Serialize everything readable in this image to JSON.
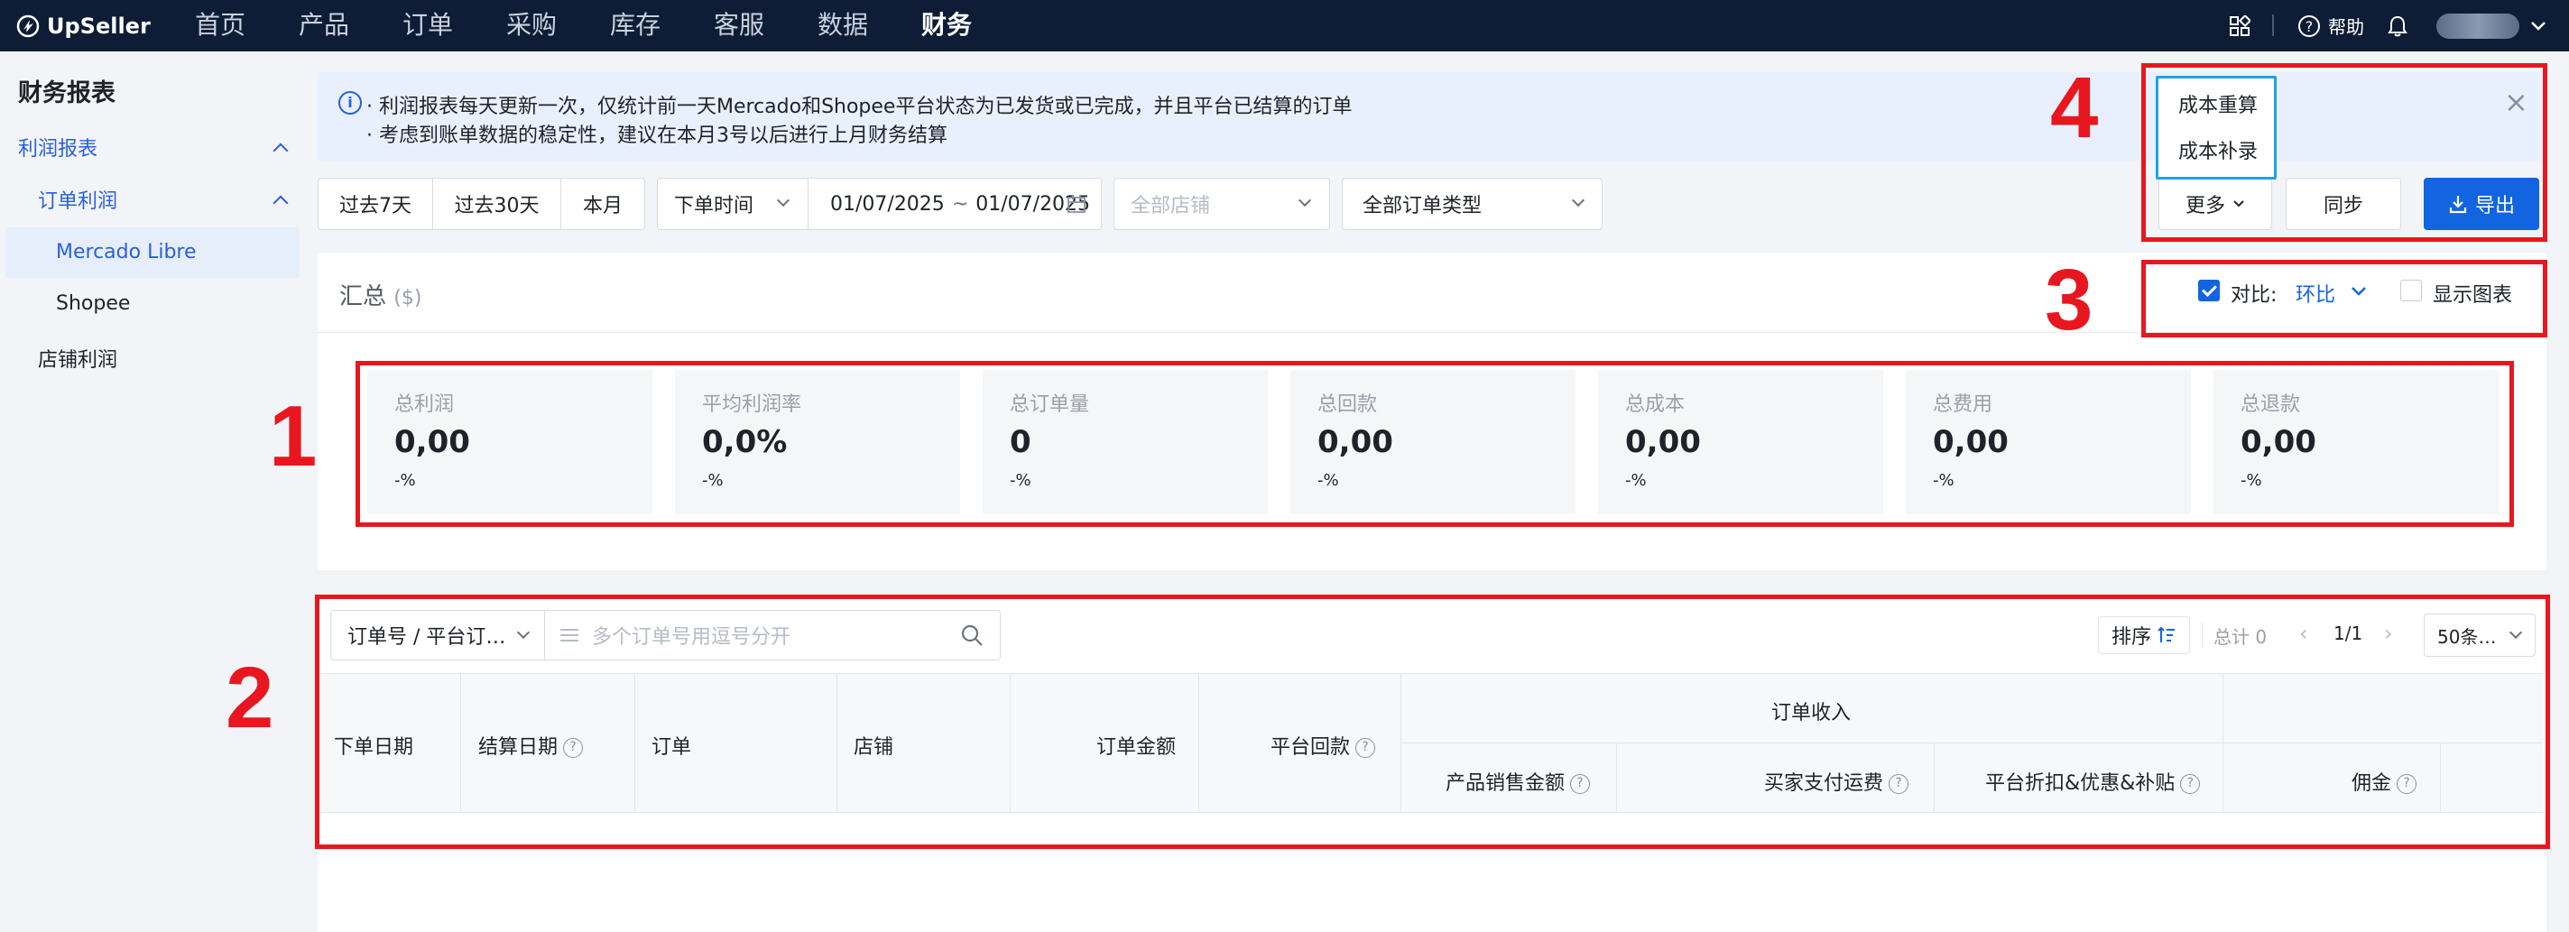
{
  "brand": {
    "name": "UpSeller"
  },
  "nav": {
    "items": [
      "首页",
      "产品",
      "订单",
      "采购",
      "库存",
      "客服",
      "数据",
      "财务"
    ],
    "active": "财务",
    "help": "帮助"
  },
  "sidebar": {
    "title": "财务报表",
    "profit_report": "利润报表",
    "order_profit": "订单利润",
    "mercado": "Mercado Libre",
    "shopee": "Shopee",
    "store_profit": "店铺利润"
  },
  "banner": {
    "line1": "· 利润报表每天更新一次，仅统计前一天Mercado和Shopee平台状态为已发货或已完成，并且平台已结算的订单",
    "line2": "· 考虑到账单数据的稳定性，建议在本月3号以后进行上月财务结算"
  },
  "filters": {
    "range_7": "过去7天",
    "range_30": "过去30天",
    "this_month": "本月",
    "time_type": "下单时间",
    "date_start": "01/07/2025",
    "date_sep": "~",
    "date_end": "01/07/2025",
    "store_placeholder": "全部店铺",
    "order_type": "全部订单类型"
  },
  "actions": {
    "more": "更多",
    "sync": "同步",
    "export": "导出",
    "menu": [
      "成本重算",
      "成本补录"
    ]
  },
  "summary": {
    "title": "汇总",
    "unit": "($)",
    "compare_label": "对比:",
    "compare_value": "环比",
    "compare_checked": true,
    "show_chart_label": "显示图表",
    "show_chart_checked": false,
    "metrics": [
      {
        "label": "总利润",
        "value": "0,00",
        "change": "-%"
      },
      {
        "label": "平均利润率",
        "value": "0,0%",
        "change": "-%"
      },
      {
        "label": "总订单量",
        "value": "0",
        "change": "-%"
      },
      {
        "label": "总回款",
        "value": "0,00",
        "change": "-%"
      },
      {
        "label": "总成本",
        "value": "0,00",
        "change": "-%"
      },
      {
        "label": "总费用",
        "value": "0,00",
        "change": "-%"
      },
      {
        "label": "总退款",
        "value": "0,00",
        "change": "-%"
      }
    ]
  },
  "table": {
    "search_field": "订单号 / 平台订…",
    "search_placeholder": "多个订单号用逗号分开",
    "sort_label": "排序",
    "total": "总计 0",
    "page": "1/1",
    "page_size": "50条…",
    "headers": {
      "order_date": "下单日期",
      "settle_date": "结算日期",
      "order": "订单",
      "store": "店铺",
      "order_amount": "订单金额",
      "platform_payout": "平台回款",
      "order_income": "订单收入",
      "product_sales": "产品销售金额",
      "buyer_shipping": "买家支付运费",
      "platform_discount": "平台折扣&优惠&补贴",
      "commission": "佣金"
    }
  },
  "annotations": {
    "box1": "1",
    "box2": "2",
    "box3": "3",
    "box4": "4"
  },
  "colors": {
    "annotation": "#e8171f",
    "primary": "#1264e0",
    "nav_bg": "#0e1d35"
  }
}
